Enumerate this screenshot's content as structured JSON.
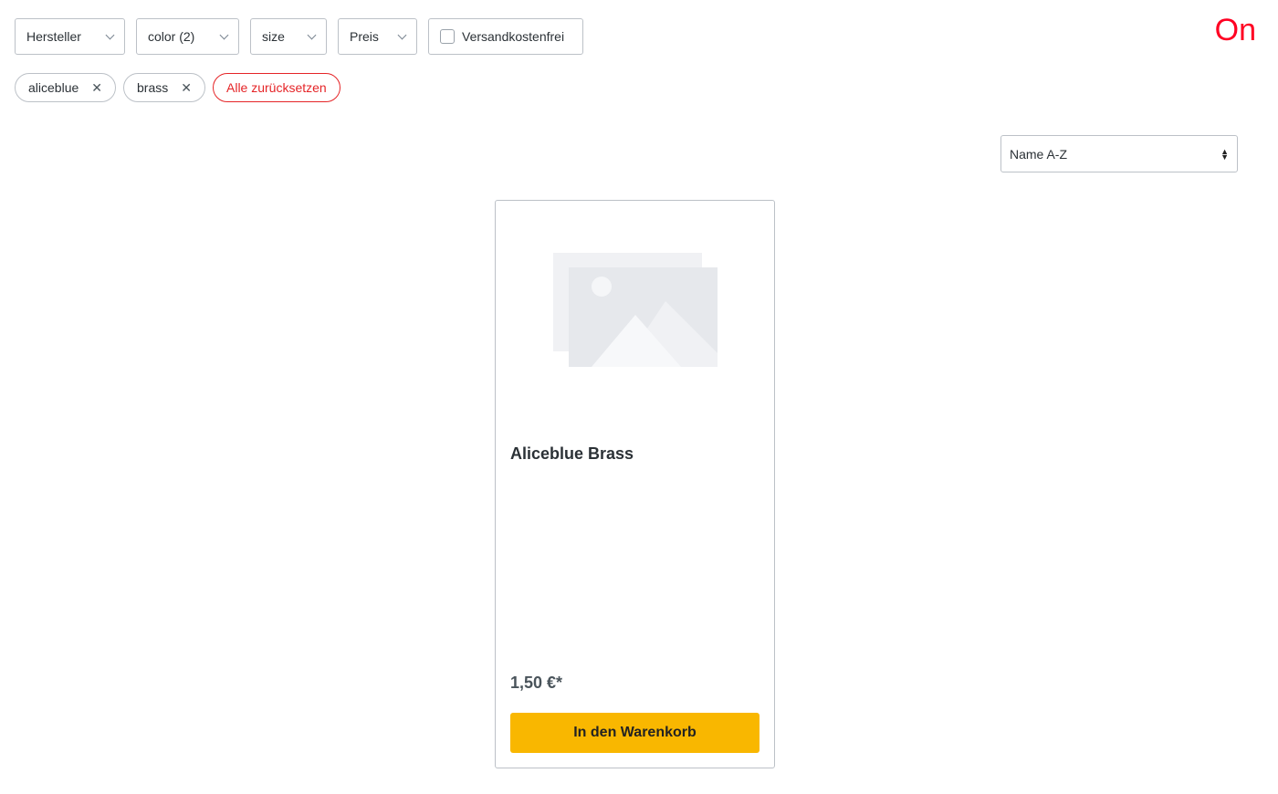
{
  "filters": [
    {
      "label": "Hersteller"
    },
    {
      "label": "color (2)"
    },
    {
      "label": "size"
    },
    {
      "label": "Preis"
    }
  ],
  "shipping_free": {
    "label": "Versandkostenfrei",
    "checked": false
  },
  "active_filters": [
    {
      "label": "aliceblue"
    },
    {
      "label": "brass"
    }
  ],
  "reset_label": "Alle zurücksetzen",
  "corner_text": "On",
  "sort": {
    "value": "Name A-Z"
  },
  "product": {
    "name": "Aliceblue Brass",
    "price": "1,50 €*",
    "buy_label": "In den Warenkorb",
    "image_icon": "image-placeholder-icon"
  },
  "colors": {
    "accent": "#e52427",
    "buy": "#f9b700",
    "corner": "#ff0022"
  }
}
